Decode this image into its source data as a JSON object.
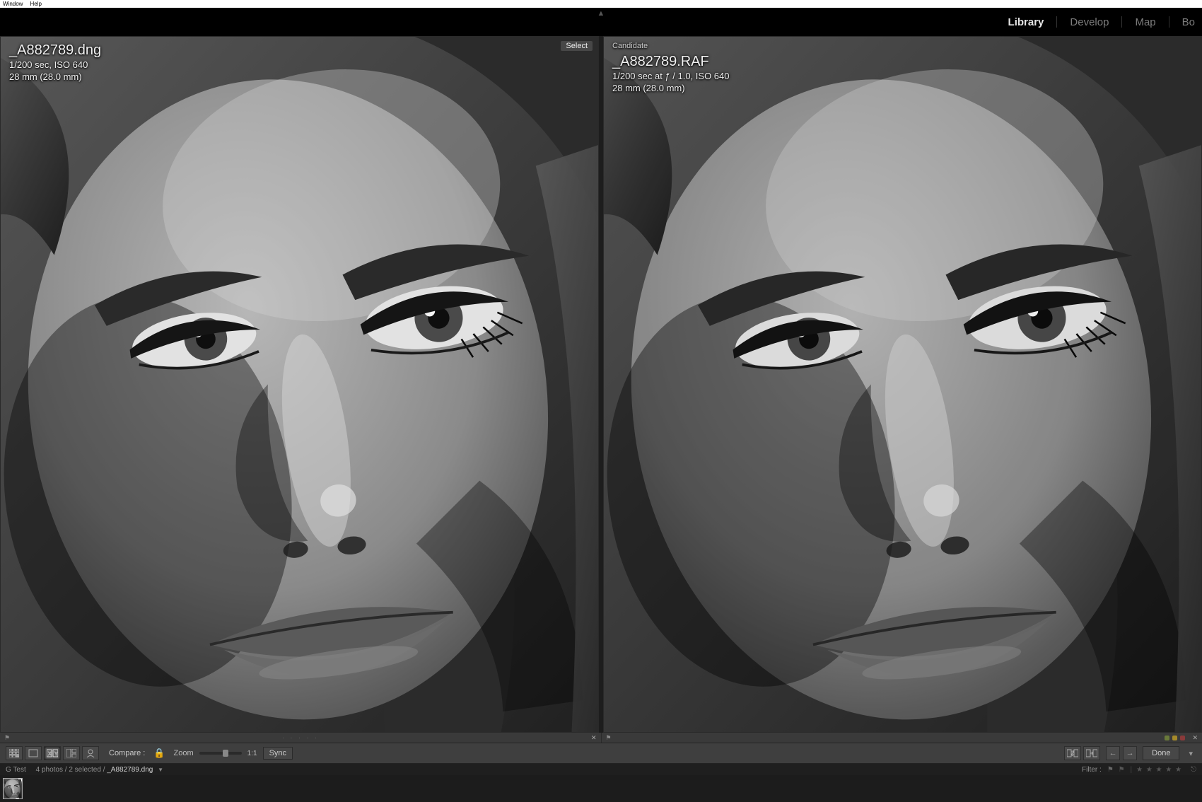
{
  "os_menu": {
    "window": "Window",
    "help": "Help"
  },
  "modules": {
    "library": "Library",
    "develop": "Develop",
    "map": "Map",
    "book": "Bo"
  },
  "active_module": "library",
  "left_panel": {
    "select_badge": "Select",
    "filename": "_A882789.dng",
    "exposure": "1/200 sec, ISO 640",
    "focal": "28 mm (28.0 mm)"
  },
  "right_panel": {
    "tag": "Candidate",
    "filename": "_A882789.RAF",
    "exposure": "1/200 sec at ƒ / 1.0, ISO 640",
    "focal": "28 mm (28.0 mm)"
  },
  "toolbar": {
    "compare_label": "Compare :",
    "zoom_label": "Zoom",
    "ratio_label": "1:1",
    "sync_label": "Sync",
    "done_label": "Done"
  },
  "breadcrumb": {
    "folder": "G Test",
    "stats": "4 photos / 2 selected /",
    "current": "_A882789.dng",
    "filter_label": "Filter :"
  },
  "filmstrip": {
    "thumbs": [
      {
        "selected": true
      }
    ]
  }
}
